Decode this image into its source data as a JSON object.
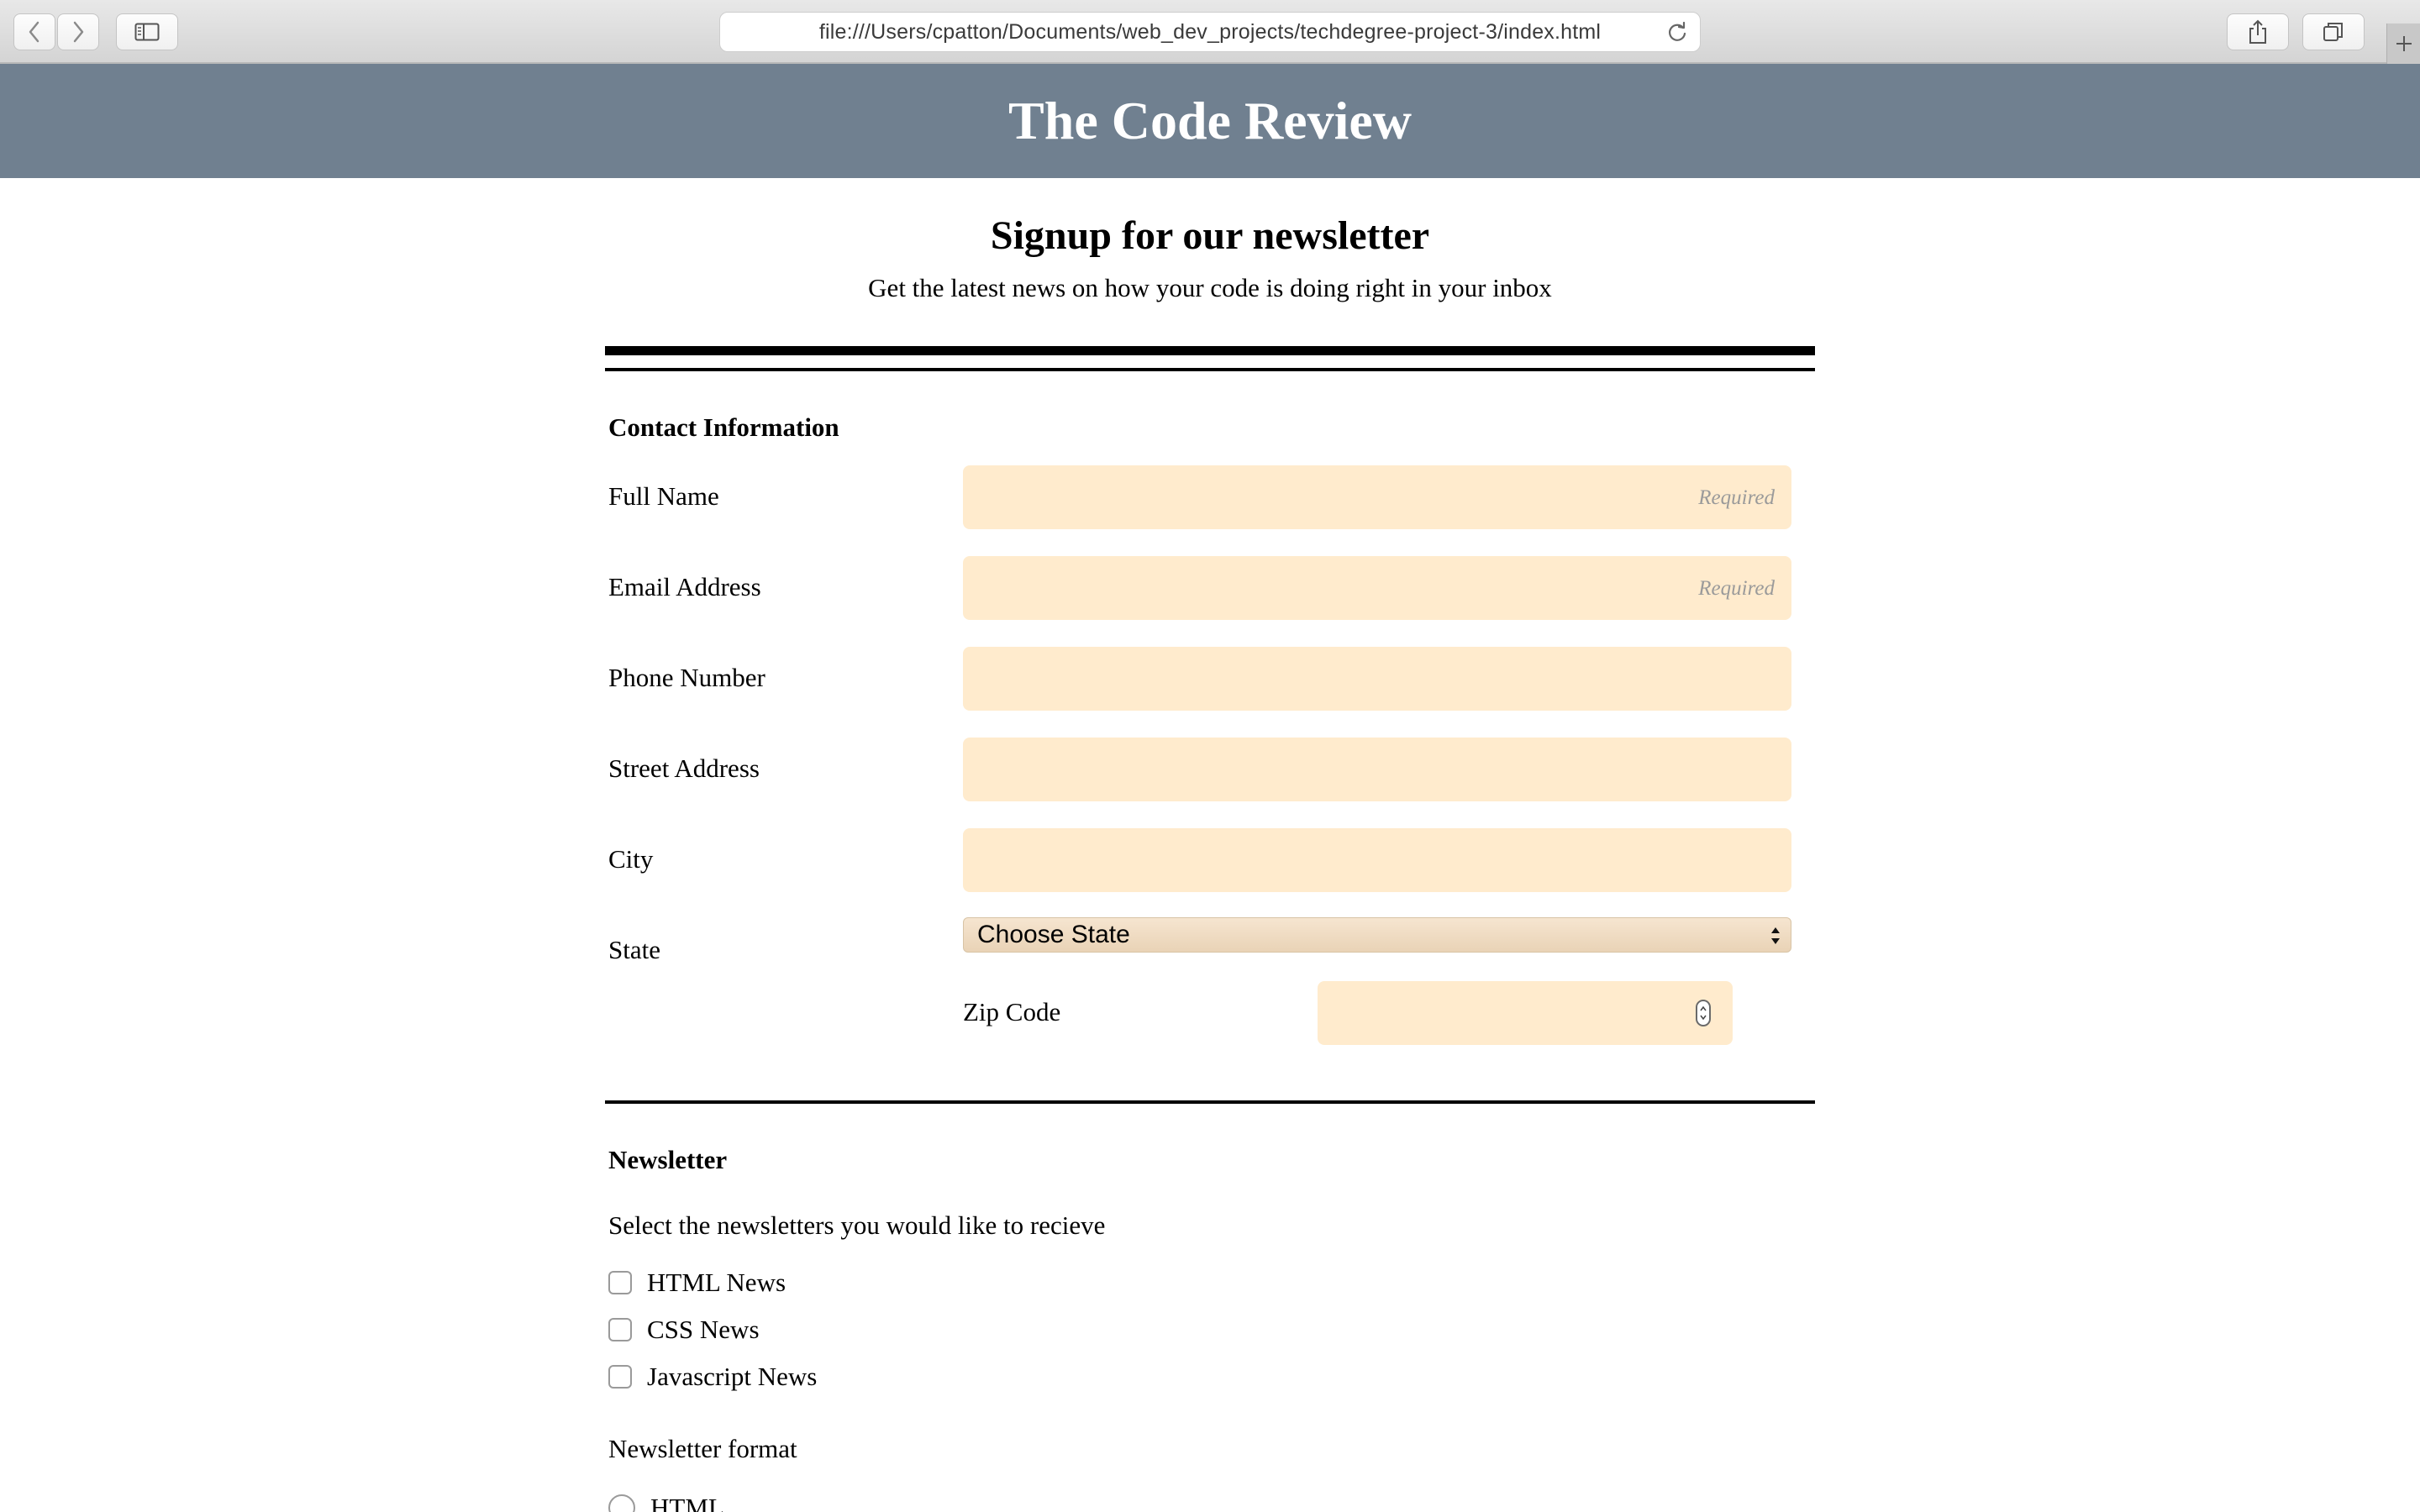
{
  "browser": {
    "url": "file:///Users/cpatton/Documents/web_dev_projects/techdegree-project-3/index.html",
    "icons": [
      "back-icon",
      "forward-icon",
      "sidebar-icon",
      "reload-icon",
      "share-icon",
      "tabs-icon",
      "plus-icon"
    ]
  },
  "site": {
    "title": "The Code Review",
    "header_color": "#708090"
  },
  "signup": {
    "title": "Signup for our newsletter",
    "subtitle": "Get the latest news on how your code is doing right in your inbox"
  },
  "contact": {
    "legend": "Contact Information",
    "fields": [
      {
        "label": "Full Name",
        "placeholder": "Required",
        "value": ""
      },
      {
        "label": "Email Address",
        "placeholder": "Required",
        "value": ""
      },
      {
        "label": "Phone Number",
        "placeholder": "",
        "value": ""
      },
      {
        "label": "Street Address",
        "placeholder": "",
        "value": ""
      },
      {
        "label": "City",
        "placeholder": "",
        "value": ""
      }
    ],
    "state": {
      "label": "State",
      "selected": "Choose State"
    },
    "zip": {
      "label": "Zip Code",
      "value": ""
    },
    "input_color": "#ffebcd"
  },
  "newsletter": {
    "legend": "Newsletter",
    "prompt": "Select the newsletters you would like to recieve",
    "options": [
      {
        "label": "HTML News",
        "checked": false
      },
      {
        "label": "CSS News",
        "checked": false
      },
      {
        "label": "Javascript News",
        "checked": false
      }
    ],
    "format_label": "Newsletter format",
    "formats": [
      {
        "label": "HTML",
        "selected": false
      }
    ]
  }
}
